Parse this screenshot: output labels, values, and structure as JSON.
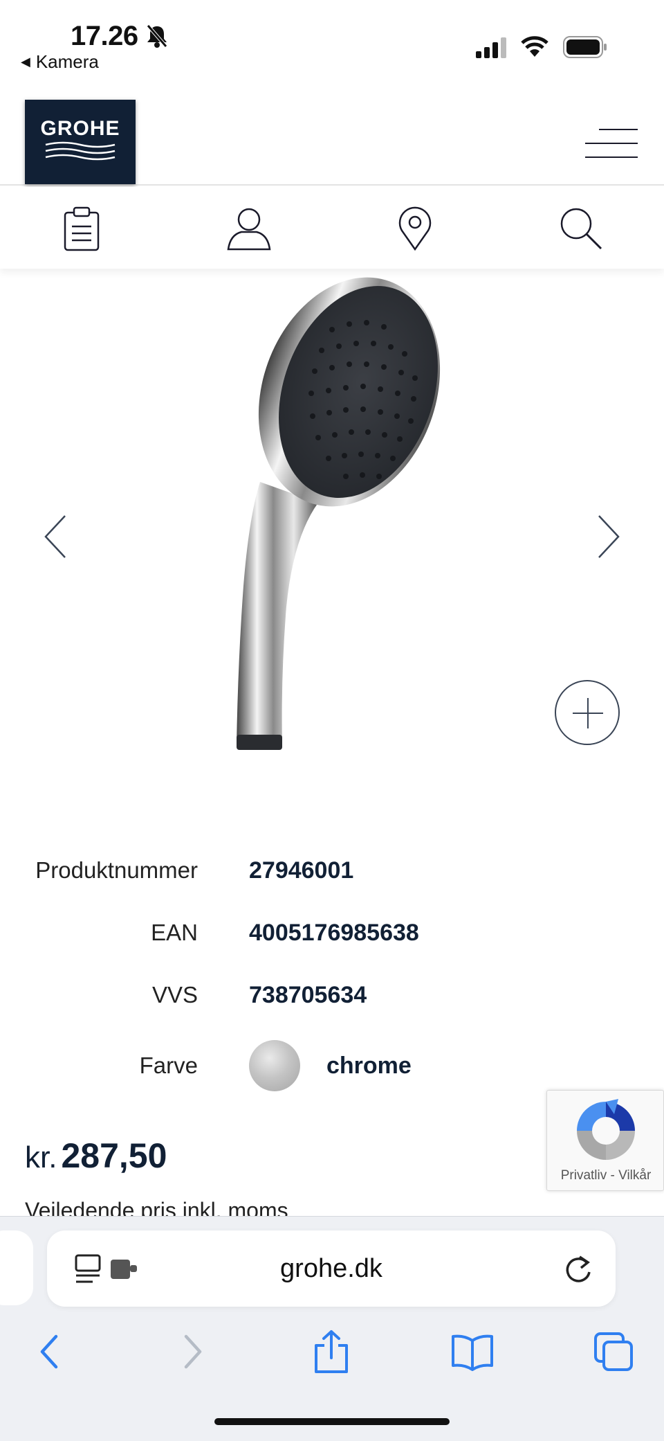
{
  "status_bar": {
    "time": "17.26",
    "back_app": "Kamera"
  },
  "header": {
    "logo_text": "GROHE"
  },
  "icons": [
    "clipboard-icon",
    "user-icon",
    "location-pin-icon",
    "search-icon"
  ],
  "product": {
    "details": [
      {
        "label": "Produktnummer",
        "value": "27946001"
      },
      {
        "label": "EAN",
        "value": "4005176985638"
      },
      {
        "label": "VVS",
        "value": "738705634"
      },
      {
        "label": "Farve",
        "value": "chrome"
      }
    ],
    "price_currency": "kr.",
    "price_amount": "287,50",
    "vat_note": "Vejledende pris inkl. moms"
  },
  "recaptcha": {
    "links": "Privatliv - Vilkår"
  },
  "browser": {
    "url": "grohe.dk"
  },
  "colors": {
    "brand_navy": "#112035",
    "safari_blue": "#2f7ff0"
  }
}
